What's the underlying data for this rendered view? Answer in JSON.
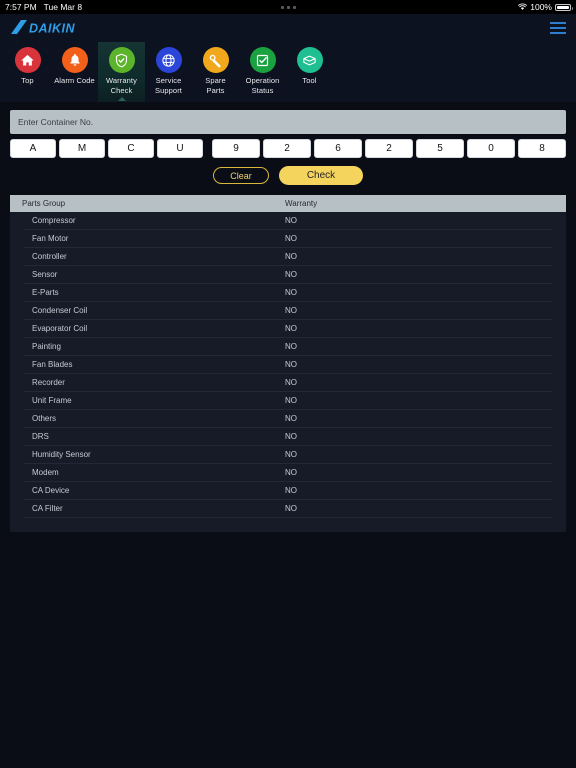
{
  "statusbar": {
    "time": "7:57 PM",
    "date": "Tue Mar 8",
    "battery_percent": "100%",
    "wifi_icon": "wifi-icon",
    "battery_icon": "battery-icon",
    "center_dots_icon": "more-dots-icon"
  },
  "header": {
    "brand": "DAIKIN",
    "menu_icon": "hamburger-menu-icon"
  },
  "nav": {
    "items": [
      {
        "label_line1": "Top",
        "label_line2": "",
        "icon": "home-icon",
        "color": "#d9343c",
        "active": false
      },
      {
        "label_line1": "Alarm Code",
        "label_line2": "",
        "icon": "bell-icon",
        "color": "#f2601a",
        "active": false
      },
      {
        "label_line1": "Warranty",
        "label_line2": "Check",
        "icon": "shield-check-icon",
        "color": "#5cb42b",
        "active": true
      },
      {
        "label_line1": "Service",
        "label_line2": "Support",
        "icon": "globe-icon",
        "color": "#2a45d8",
        "active": false
      },
      {
        "label_line1": "Spare",
        "label_line2": "Parts",
        "icon": "wrench-icon",
        "color": "#f2a81c",
        "active": false
      },
      {
        "label_line1": "Operation",
        "label_line2": "Status",
        "icon": "checklist-icon",
        "color": "#1aa241",
        "active": false
      },
      {
        "label_line1": "Tool",
        "label_line2": "",
        "icon": "toolbox-icon",
        "color": "#1fbf92",
        "active": false
      }
    ]
  },
  "container_input": {
    "placeholder": "Enter Container No.",
    "value": "",
    "cells": [
      {
        "char": "A",
        "type": "letter"
      },
      {
        "char": "M",
        "type": "letter"
      },
      {
        "char": "C",
        "type": "letter"
      },
      {
        "char": "U",
        "type": "letter"
      },
      {
        "char": "9",
        "type": "digit"
      },
      {
        "char": "2",
        "type": "digit"
      },
      {
        "char": "6",
        "type": "digit"
      },
      {
        "char": "2",
        "type": "digit"
      },
      {
        "char": "5",
        "type": "digit"
      },
      {
        "char": "0",
        "type": "digit"
      },
      {
        "char": "8",
        "type": "digit"
      }
    ],
    "clear_label": "Clear",
    "check_label": "Check"
  },
  "results_table": {
    "headers": {
      "parts_group": "Parts Group",
      "warranty": "Warranty"
    },
    "rows": [
      {
        "parts_group": "Compressor",
        "warranty": "NO"
      },
      {
        "parts_group": "Fan Motor",
        "warranty": "NO"
      },
      {
        "parts_group": "Controller",
        "warranty": "NO"
      },
      {
        "parts_group": "Sensor",
        "warranty": "NO"
      },
      {
        "parts_group": "E-Parts",
        "warranty": "NO"
      },
      {
        "parts_group": "Condenser Coil",
        "warranty": "NO"
      },
      {
        "parts_group": "Evaporator Coil",
        "warranty": "NO"
      },
      {
        "parts_group": "Painting",
        "warranty": "NO"
      },
      {
        "parts_group": "Fan Blades",
        "warranty": "NO"
      },
      {
        "parts_group": "Recorder",
        "warranty": "NO"
      },
      {
        "parts_group": "Unit Frame",
        "warranty": "NO"
      },
      {
        "parts_group": "Others",
        "warranty": "NO"
      },
      {
        "parts_group": "DRS",
        "warranty": "NO"
      },
      {
        "parts_group": "Humidity Sensor",
        "warranty": "NO"
      },
      {
        "parts_group": "Modem",
        "warranty": "NO"
      },
      {
        "parts_group": "CA Device",
        "warranty": "NO"
      },
      {
        "parts_group": "CA Filter",
        "warranty": "NO"
      }
    ]
  },
  "colors": {
    "page_bg": "#0a0d16",
    "panel_bg": "#161b27",
    "header_bg": "#0d1220",
    "accent_yellow": "#f5d45e",
    "brand_blue": "#2f9ee8",
    "field_gray": "#b7c0c4"
  }
}
